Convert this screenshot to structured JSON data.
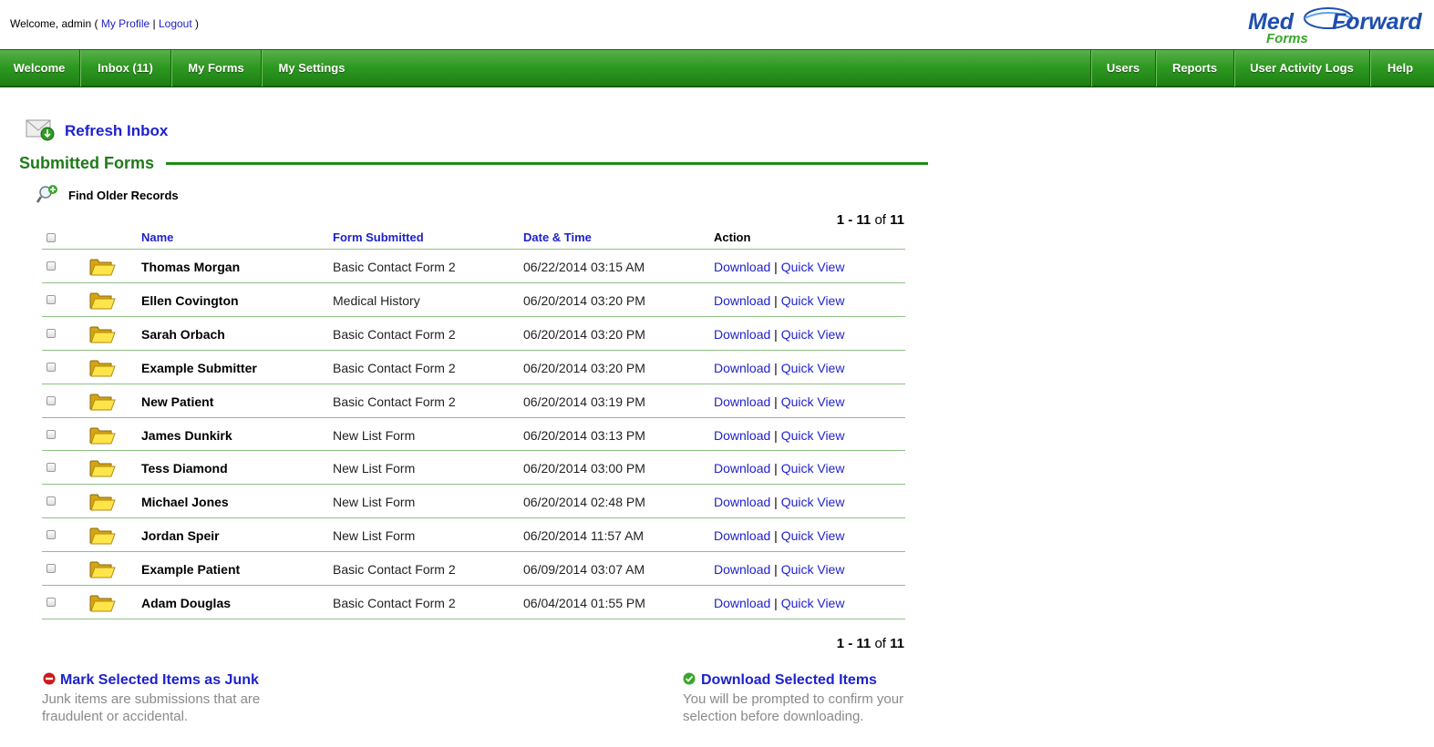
{
  "header": {
    "welcome_text": "Welcome, admin (",
    "my_profile": "My Profile",
    "sep": "|",
    "logout": "Logout",
    "close_paren": ")",
    "logo_med": "Med",
    "logo_forward": "Forward",
    "logo_forms": "Forms"
  },
  "nav": {
    "left": [
      "Welcome",
      "Inbox (11)",
      "My Forms",
      "My Settings"
    ],
    "right": [
      "Users",
      "Reports",
      "User Activity Logs",
      "Help"
    ]
  },
  "refresh_label": "Refresh Inbox",
  "section_title": "Submitted Forms",
  "find_older": "Find Older Records",
  "pager": {
    "range": "1 - 11",
    "of": "of",
    "total": "11"
  },
  "columns": {
    "name": "Name",
    "form": "Form Submitted",
    "date": "Date & Time",
    "action": "Action"
  },
  "action_labels": {
    "download": "Download",
    "sep": "|",
    "quick_view": "Quick View"
  },
  "rows": [
    {
      "name": "Thomas Morgan",
      "form": "Basic Contact Form 2",
      "date": "06/22/2014 03:15 AM"
    },
    {
      "name": "Ellen Covington",
      "form": "Medical History",
      "date": "06/20/2014 03:20 PM"
    },
    {
      "name": "Sarah Orbach",
      "form": "Basic Contact Form 2",
      "date": "06/20/2014 03:20 PM"
    },
    {
      "name": "Example Submitter",
      "form": "Basic Contact Form 2",
      "date": "06/20/2014 03:20 PM"
    },
    {
      "name": "New Patient",
      "form": "Basic Contact Form 2",
      "date": "06/20/2014 03:19 PM"
    },
    {
      "name": "James Dunkirk",
      "form": "New List Form",
      "date": "06/20/2014 03:13 PM"
    },
    {
      "name": "Tess Diamond",
      "form": "New List Form",
      "date": "06/20/2014 03:00 PM"
    },
    {
      "name": "Michael Jones",
      "form": "New List Form",
      "date": "06/20/2014 02:48 PM"
    },
    {
      "name": "Jordan Speir",
      "form": "New List Form",
      "date": "06/20/2014 11:57 AM"
    },
    {
      "name": "Example Patient",
      "form": "Basic Contact Form 2",
      "date": "06/09/2014 03:07 AM"
    },
    {
      "name": "Adam Douglas",
      "form": "Basic Contact Form 2",
      "date": "06/04/2014 01:55 PM"
    }
  ],
  "footer": {
    "junk_title": "Mark Selected Items as Junk",
    "junk_desc": "Junk items are submissions that are fraudulent or accidental.",
    "download_title": "Download Selected Items",
    "download_desc": "You will be prompted to confirm your selection before downloading."
  },
  "colors": {
    "nav_green": "#2f9a22",
    "link_blue": "#1e22cc",
    "title_green": "#1f7a1a"
  },
  "icons": [
    "refresh-inbox-icon",
    "find-older-icon",
    "folder-icon",
    "junk-icon",
    "download-check-icon"
  ]
}
